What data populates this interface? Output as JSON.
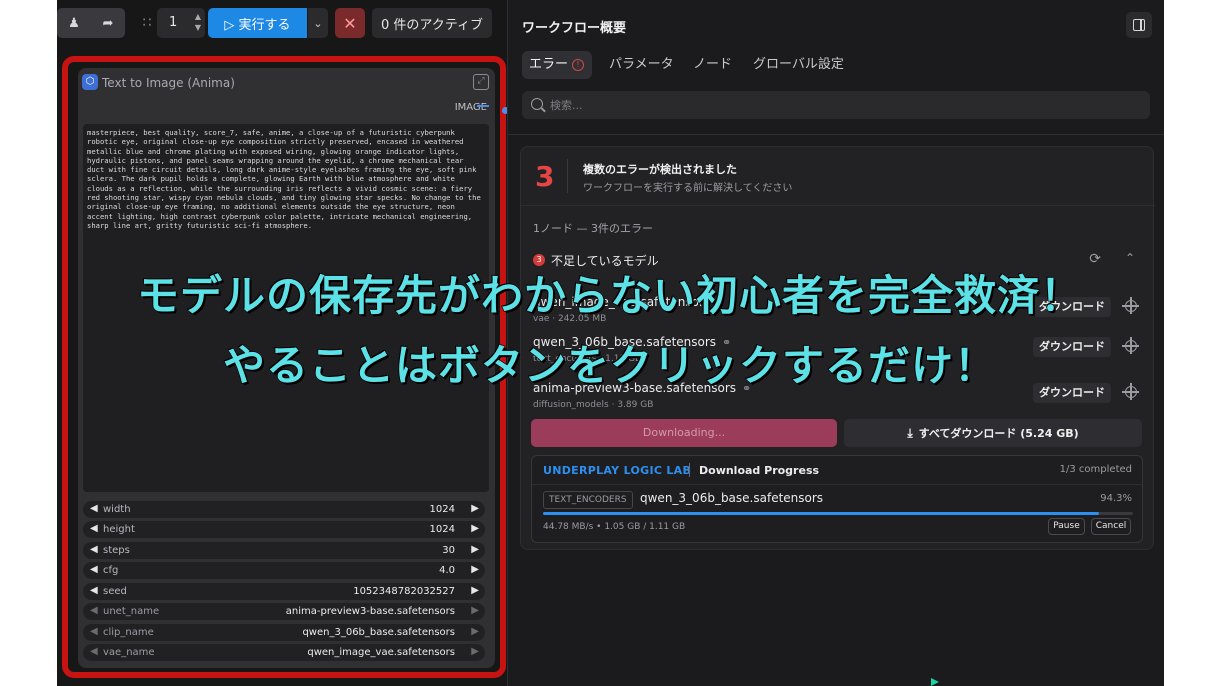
{
  "toolbar": {
    "left_icons": [
      "♟",
      "➦"
    ],
    "grip": "∷",
    "queue_count": "1",
    "run_label": "▷ 実行する",
    "run_caret": "⌄",
    "cancel_symbol": "✕",
    "active_label": "0 件のアクティブ"
  },
  "node": {
    "icon": "⬡",
    "title": "Text to Image (Anima)",
    "expand_icon": "⤢",
    "output_label": "IMAGE",
    "prompt": "masterpiece, best quality, score_7, safe, anime, a close-up of a futuristic cyberpunk robotic eye, original close-up eye composition strictly preserved, encased in weathered metallic blue and chrome plating with exposed wiring, glowing orange indicator lights, hydraulic pistons, and panel seams wrapping around the eyelid, a chrome mechanical tear duct with fine circuit details, long dark anime-style eyelashes framing the eye, soft pink sclera. The dark pupil holds a complete, glowing Earth with blue atmosphere and white clouds as a reflection, while the surrounding iris reflects a vivid cosmic scene: a fiery red shooting star, wispy cyan nebula clouds, and tiny glowing star specks. No change to the original close-up eye framing, no additional elements outside the eye structure, neon accent lighting, high contrast cyberpunk color palette, intricate mechanical engineering, sharp line art, gritty futuristic sci-fi atmosphere.",
    "widgets": [
      {
        "label": "width",
        "value": "1024"
      },
      {
        "label": "height",
        "value": "1024"
      },
      {
        "label": "steps",
        "value": "30"
      },
      {
        "label": "cfg",
        "value": "4.0"
      },
      {
        "label": "seed",
        "value": "1052348782032527"
      }
    ],
    "combos": [
      {
        "label": "unet_name",
        "value": "anima-preview3-base.safetensors"
      },
      {
        "label": "clip_name",
        "value": "qwen_3_06b_base.safetensors"
      },
      {
        "label": "vae_name",
        "value": "qwen_image_vae.safetensors"
      }
    ]
  },
  "panel": {
    "title": "ワークフロー概要",
    "tabs": [
      "エラー",
      "パラメータ",
      "ノード",
      "グローバル設定"
    ],
    "error_tab_icon": "!",
    "search_placeholder": "検索...",
    "error_count": "3",
    "error_heading": "複数のエラーが検出されました",
    "error_sub": "ワークフローを実行する前に解決してください",
    "error_summary": "1ノード — 3件のエラー",
    "missing_badge": "3",
    "missing_title": "不足しているモデル",
    "refresh_icon": "⟳",
    "collapse_icon": "⌃",
    "models": [
      {
        "name": "qwen_image_vae.safetensors",
        "meta": "vae · 242.05 MB",
        "button": "ダウンロード"
      },
      {
        "name": "qwen_3_06b_base.safetensors",
        "meta": "text_encoders · 1.11 GB",
        "button": "ダウンロード"
      },
      {
        "name": "anima-preview3-base.safetensors",
        "meta": "diffusion_models · 3.89 GB",
        "button": "ダウンロード"
      }
    ],
    "link_icon": "⚭",
    "downloading_label": "Downloading...",
    "download_all_icon": "⤓",
    "download_all_label": "すべてダウンロード (5.24 GB)",
    "progress": {
      "brand": "UNDERPLAY LOGIC LAB",
      "title": "Download Progress",
      "completed": "1/3 completed",
      "tag": "TEXT_ENCODERS",
      "file": "qwen_3_06b_base.safetensors",
      "percent_label": "94.3%",
      "fraction": 0.943,
      "speed": "44.78 MB/s • 1.05 GB / 1.11 GB",
      "pause_label": "Pause",
      "cancel_label": "Cancel"
    }
  },
  "caption": {
    "line1": "モデルの保存先がわからない初心者を完全救済！",
    "line2": "やることはボタンをクリックするだけ！"
  },
  "colors": {
    "accent": "#1e88e5",
    "progress": "#2d8ff0",
    "error": "#e64545",
    "frame": "#c81313",
    "caption": "#5ce1e6"
  }
}
